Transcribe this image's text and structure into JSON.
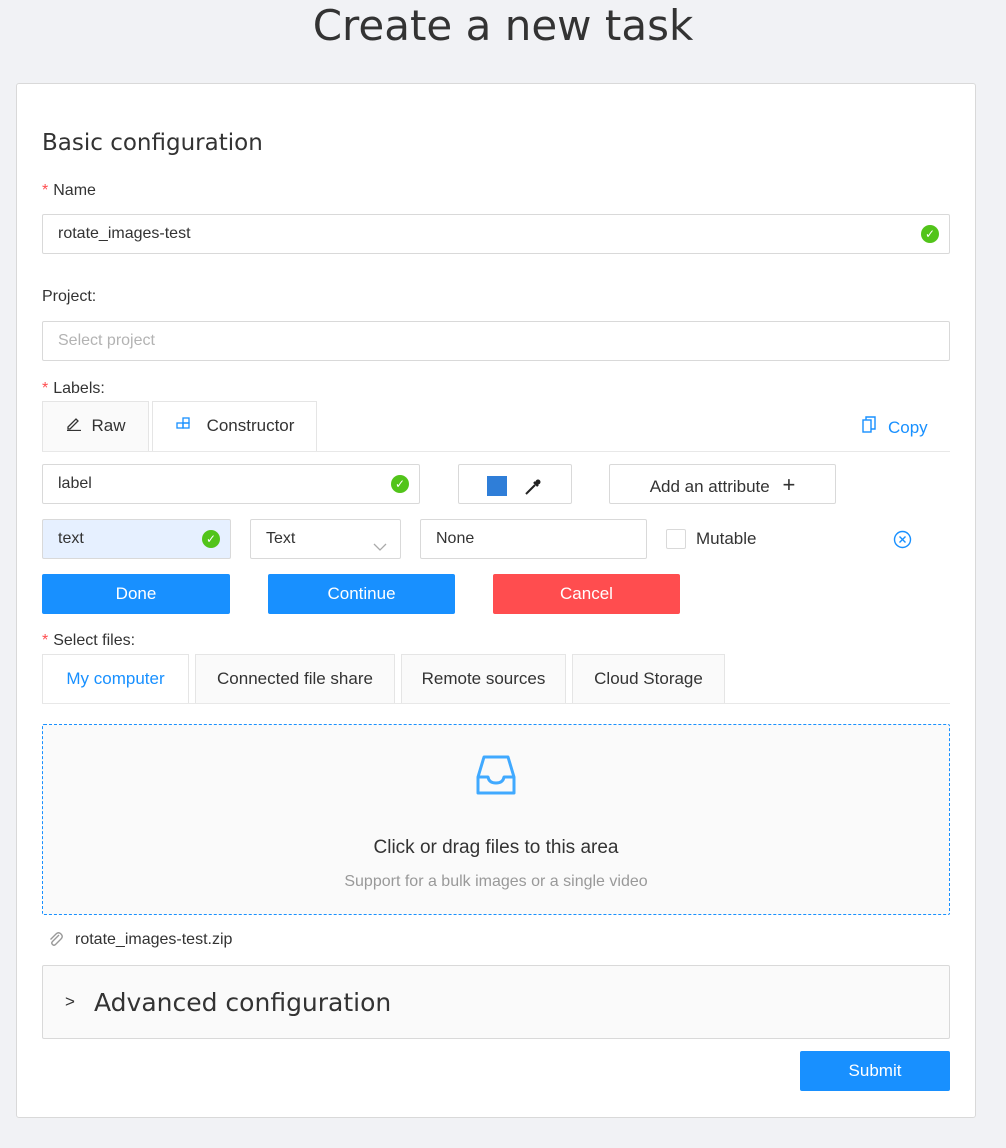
{
  "page": {
    "title": "Create a new task"
  },
  "basic": {
    "title": "Basic configuration",
    "name_label": "Name",
    "name_value": "rotate_images-test",
    "project_label": "Project:",
    "project_placeholder": "Select project",
    "labels_label": "Labels:"
  },
  "label_tabs": {
    "raw": "Raw",
    "constructor": "Constructor",
    "copy": "Copy"
  },
  "constructor": {
    "label_value": "label",
    "label_color": "#2f7ed8",
    "add_attribute": "Add an attribute",
    "attribute_name": "text",
    "attribute_type": "Text",
    "attribute_value": "None",
    "mutable_label": "Mutable",
    "done": "Done",
    "continue": "Continue",
    "cancel": "Cancel"
  },
  "files": {
    "label": "Select files:",
    "tabs": [
      "My computer",
      "Connected file share",
      "Remote sources",
      "Cloud Storage"
    ],
    "drop_title": "Click or drag files to this area",
    "drop_hint": "Support for a bulk images or a single video",
    "uploaded": "rotate_images-test.zip"
  },
  "advanced": {
    "title": "Advanced configuration",
    "chevron": ">"
  },
  "submit": "Submit"
}
